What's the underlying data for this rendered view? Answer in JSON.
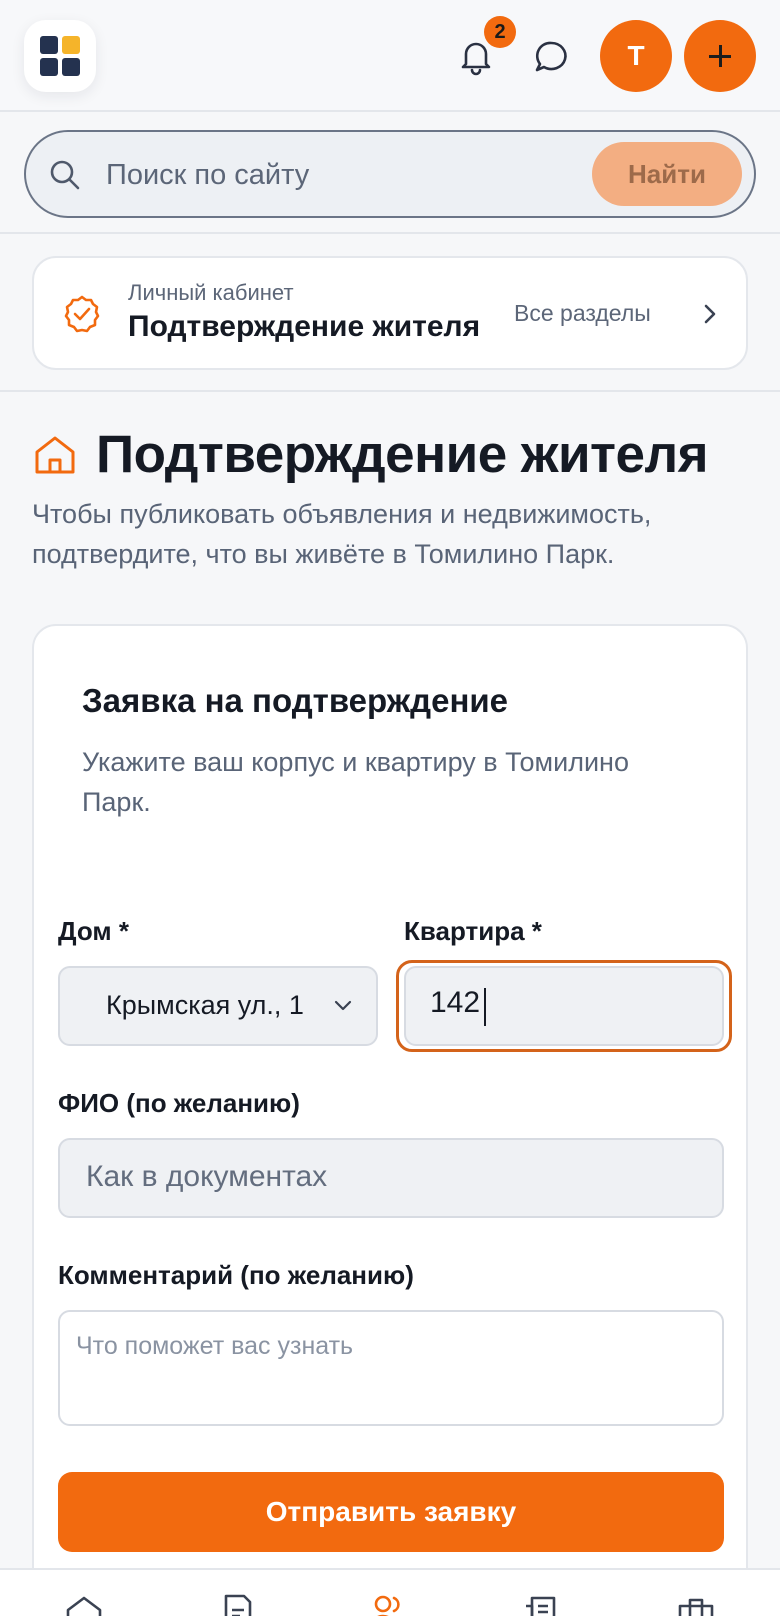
{
  "header": {
    "logo_icon": "grid-logo-icon",
    "notifications_icon": "bell-icon",
    "notifications_count": "2",
    "messages_icon": "chat-icon",
    "avatar_initial": "Т",
    "add_icon": "plus-icon"
  },
  "search": {
    "placeholder": "Поиск по сайту",
    "button_label": "Найти"
  },
  "breadcrumb": {
    "section": "Личный кабинет",
    "current": "Подтверждение жителя",
    "all_sections": "Все разделы"
  },
  "page": {
    "title": "Подтверждение жителя",
    "subtitle": "Чтобы публиковать объявления и недвижимость, подтвердите, что вы живёте в Томилино Парк."
  },
  "form": {
    "title": "Заявка на подтверждение",
    "subtitle": "Укажите ваш корпус и квартиру в Томилино Парк.",
    "house_label": "Дом *",
    "house_value": "Крымская ул., 1",
    "apartment_label": "Квартира *",
    "apartment_value": "142",
    "fio_label": "ФИО (по желанию)",
    "fio_placeholder": "Как в документах",
    "comment_label": "Комментарий (по желанию)",
    "comment_placeholder": "Что поможет вас узнать",
    "submit_label": "Отправить заявку"
  },
  "bottom_nav": {
    "items": [
      "home-icon",
      "document-icon",
      "users-icon",
      "newspaper-icon",
      "briefcase-icon"
    ],
    "active_color": "#f26a0f"
  },
  "colors": {
    "accent": "#f26a0f",
    "text": "#151a24",
    "muted": "#596477"
  }
}
